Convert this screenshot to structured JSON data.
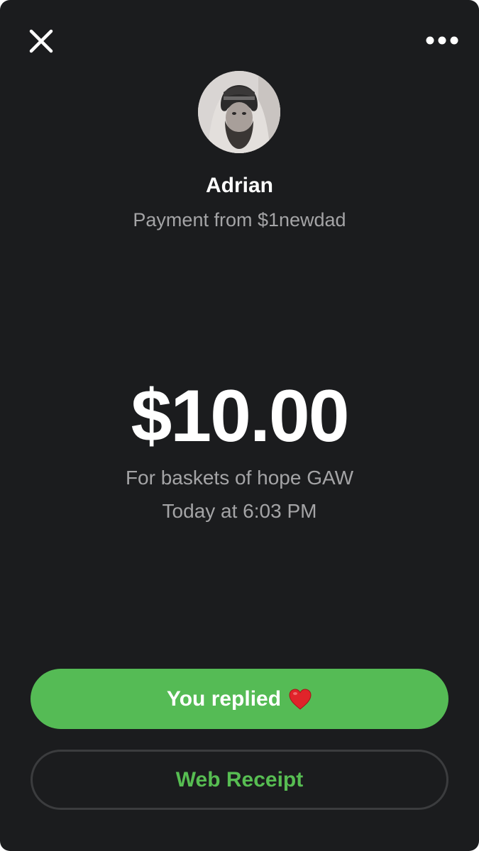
{
  "header": {
    "close_icon": "close-icon",
    "more_icon": "more-horizontal-icon"
  },
  "sender": {
    "name": "Adrian",
    "subtitle": "Payment from $1newdad",
    "avatar_icon": "profile-photo"
  },
  "payment": {
    "amount": "$10.00",
    "note": "For baskets of hope GAW",
    "time": "Today at 6:03 PM"
  },
  "actions": {
    "reply_label": "You replied",
    "reply_emoji_icon": "heart-icon",
    "receipt_label": "Web Receipt"
  },
  "colors": {
    "background": "#1b1c1e",
    "accent_green": "#55bb55",
    "receipt_text": "#57bd52",
    "secondary_text": "#a4a4a6"
  }
}
